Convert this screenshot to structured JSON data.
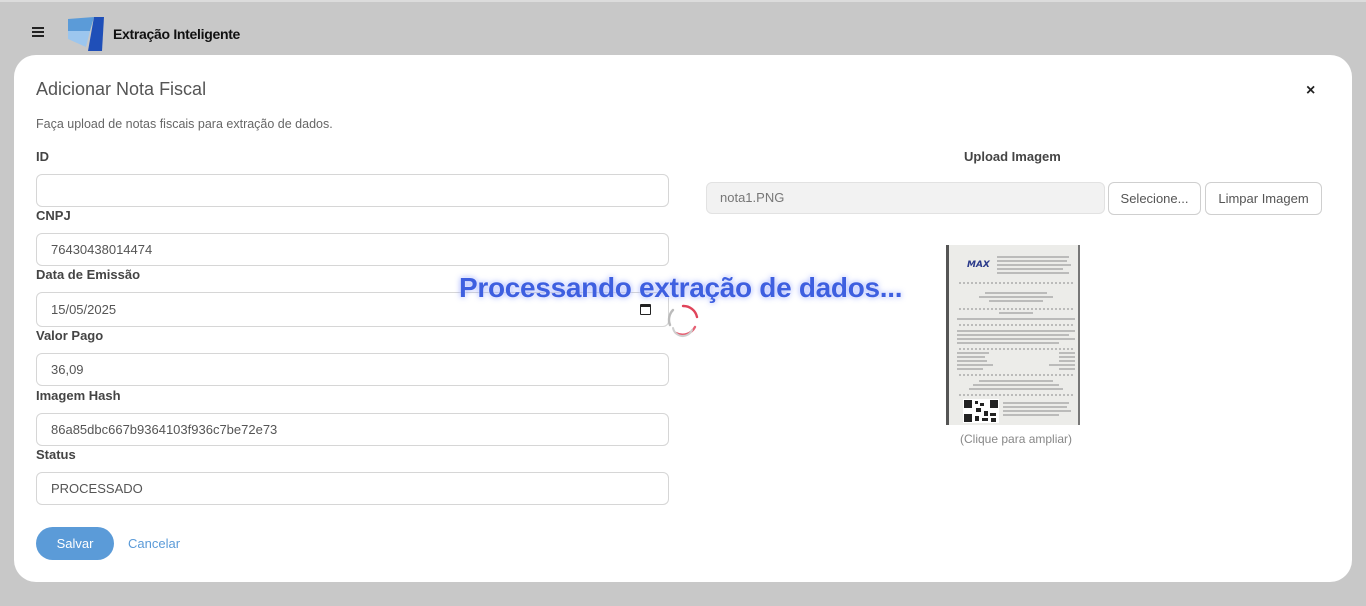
{
  "app": {
    "title": "Extração Inteligente"
  },
  "modal": {
    "title": "Adicionar Nota Fiscal",
    "description": "Faça upload de notas fiscais para extração de dados.",
    "close_label": "×"
  },
  "form": {
    "id": {
      "label": "ID",
      "value": ""
    },
    "cnpj": {
      "label": "CNPJ",
      "value": "76430438014474"
    },
    "data_emissao": {
      "label": "Data de Emissão",
      "value": "15/05/2025"
    },
    "valor_pago": {
      "label": "Valor Pago",
      "value": "36,09"
    },
    "imagem_hash": {
      "label": "Imagem Hash",
      "value": "86a85dbc667b9364103f936c7be72e73"
    },
    "status": {
      "label": "Status",
      "value": "PROCESSADO"
    }
  },
  "actions": {
    "save_label": "Salvar",
    "cancel_label": "Cancelar"
  },
  "upload": {
    "label": "Upload Imagem",
    "filename": "nota1.PNG",
    "select_label": "Selecione...",
    "clear_label": "Limpar Imagem",
    "preview_hint": "(Clique para ampliar)",
    "receipt_brand": "MAX"
  },
  "overlay": {
    "message": "Processando extração de dados..."
  },
  "colors": {
    "accent": "#5b9bd8",
    "overlay_text": "#3e5fe0",
    "spinner": "#e0445a"
  },
  "icons": {
    "menu": "hamburger-menu-icon",
    "logo": "brand-logo-icon",
    "close": "close-icon",
    "calendar": "calendar-icon",
    "spinner": "loading-spinner-icon"
  }
}
